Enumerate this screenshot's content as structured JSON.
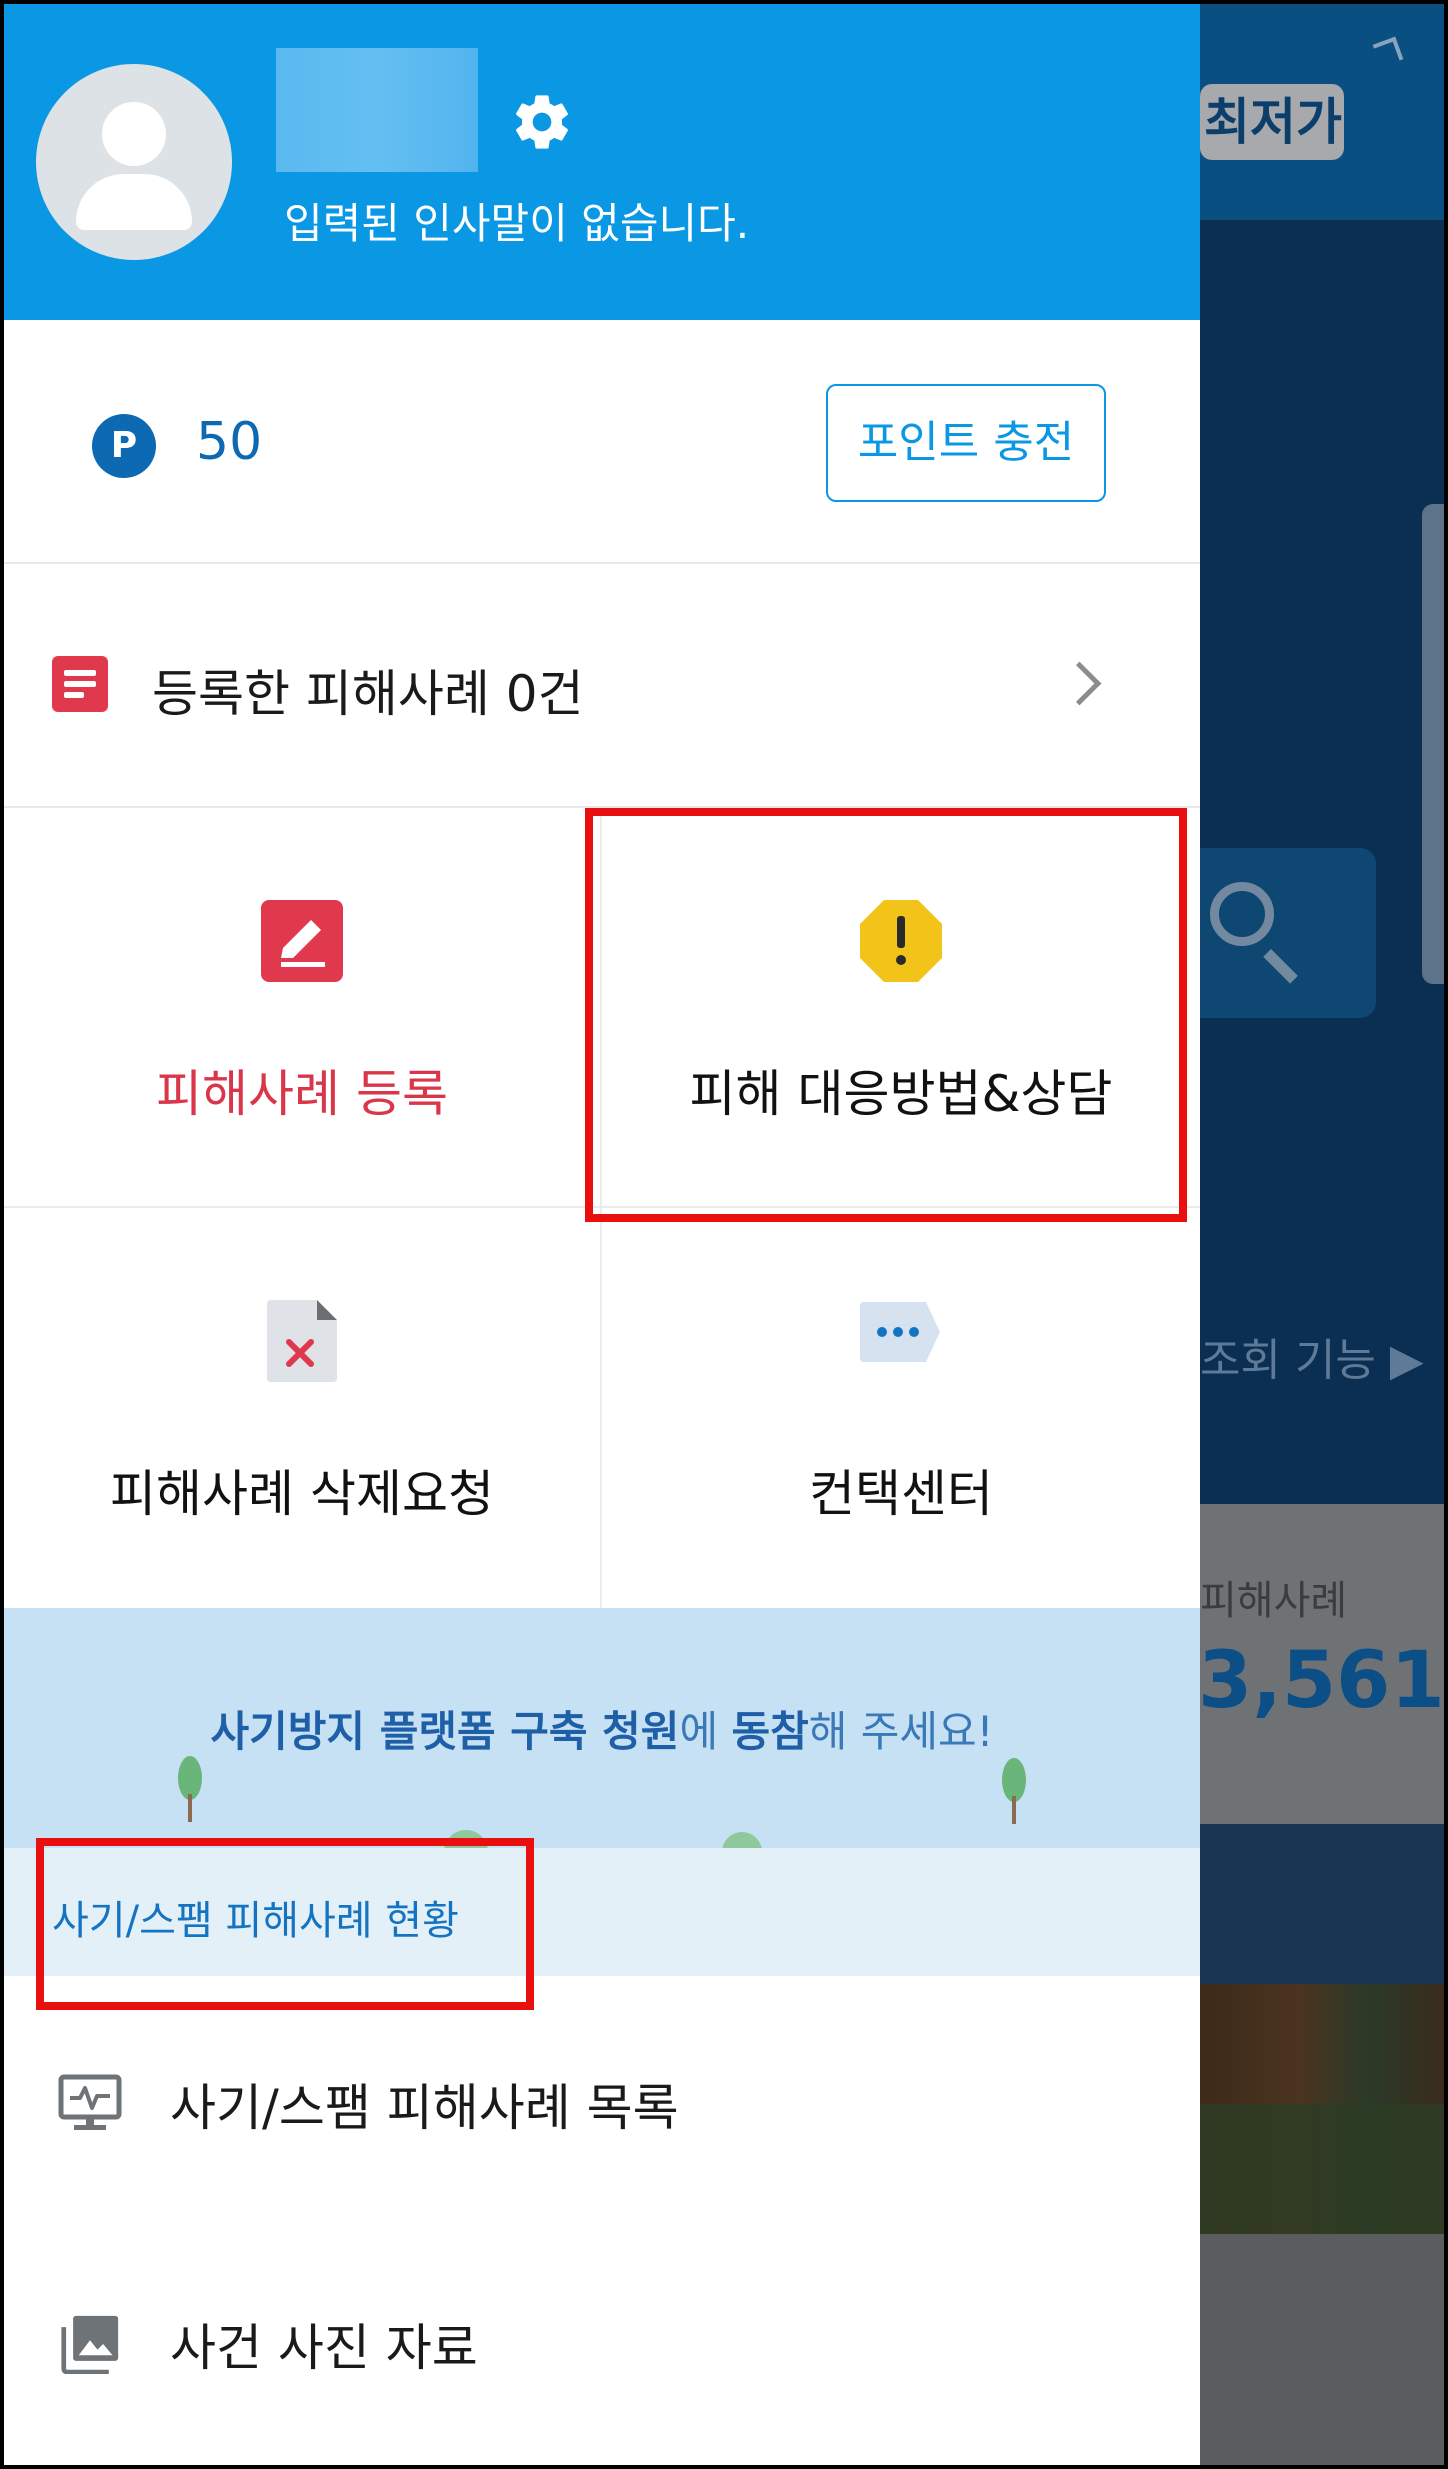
{
  "header": {
    "greeting": "입력된 인사말이 없습니다."
  },
  "points": {
    "badge": "P",
    "value": "50",
    "charge_label": "포인트 충전"
  },
  "reported": {
    "label": "등록한 피해사례 0건"
  },
  "grid": {
    "register_label": "피해사례 등록",
    "response_label": "피해 대응방법&상담",
    "delete_label": "피해사례 삭제요청",
    "contact_label": "컨택센터"
  },
  "banner": {
    "part1": "사기방지 플랫폼 구축 청원",
    "part2": "에 ",
    "part3": "동참",
    "part4": "해 주세요!"
  },
  "section": {
    "title": "사기/스팸 피해사례 현황"
  },
  "list": {
    "items": [
      {
        "label": "사기/스팸 피해사례 목록",
        "icon": "monitor-pulse-icon"
      },
      {
        "label": "사건 사진 자료",
        "icon": "photo-library-icon"
      }
    ]
  },
  "background_app": {
    "lowest_price_tag": "최저가",
    "lookup_more": "조회 기능 ▶",
    "cases_label": "피해사례",
    "cases_count": "3,561"
  },
  "colors": {
    "header_blue": "#0a98e4",
    "accent_red": "#e0394d",
    "warning_yellow": "#f2c318",
    "highlight_red": "#ea0f0f",
    "point_blue": "#0e69b3"
  }
}
